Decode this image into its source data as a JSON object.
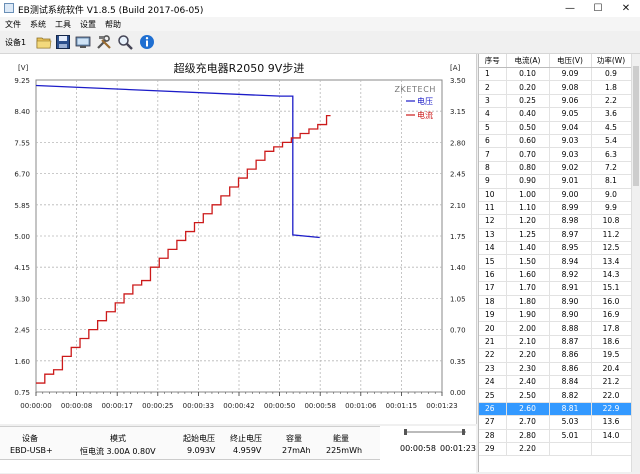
{
  "window": {
    "title": "EB测试系统软件 V1.8.5 (Build 2017-06-05)",
    "min_glyph": "—",
    "max_glyph": "☐",
    "close_glyph": "✕"
  },
  "menu": {
    "file": "文件",
    "system": "系统",
    "tools": "工具",
    "settings": "设置",
    "help": "帮助"
  },
  "toolbar": {
    "device_label": "设备1",
    "icons": [
      "open-folder-icon",
      "save-disk-icon",
      "monitor-icon",
      "tools-icon",
      "search-icon",
      "info-icon"
    ]
  },
  "chart_data": {
    "type": "line",
    "title": "超级充电器R2050 9V步进",
    "watermark": "ZKETECH",
    "left_unit": "[V]",
    "right_unit": "[A]",
    "y_left_ticks": [
      "9.25",
      "8.40",
      "7.55",
      "6.70",
      "5.85",
      "5.00",
      "4.15",
      "3.30",
      "2.45",
      "1.60",
      "0.75"
    ],
    "y_right_ticks": [
      "3.50",
      "3.15",
      "2.80",
      "2.45",
      "2.10",
      "1.75",
      "1.40",
      "1.05",
      "0.70",
      "0.35",
      "0.00"
    ],
    "x_ticks": [
      "00:00:00",
      "00:00:08",
      "00:00:17",
      "00:00:25",
      "00:00:33",
      "00:00:42",
      "00:00:50",
      "00:00:58",
      "00:01:06",
      "00:01:15",
      "00:01:23"
    ],
    "ylim_left": [
      0.75,
      9.25
    ],
    "ylim_right": [
      0.0,
      3.5
    ],
    "xlim_seconds": [
      0,
      83
    ],
    "grid": true,
    "legend_position": "top-right",
    "series": [
      {
        "name": "电压",
        "color": "#1c1cc8",
        "axis": "left",
        "x": [
          0,
          50,
          52.5,
          52.5,
          58
        ],
        "y": [
          9.1,
          8.81,
          8.81,
          5.03,
          4.96
        ]
      },
      {
        "name": "电流",
        "color": "#cc1a1a",
        "axis": "right",
        "step": true,
        "x": [
          0,
          1.8,
          3.6,
          5.4,
          7.2,
          9.0,
          10.8,
          12.6,
          14.4,
          16.2,
          18.0,
          19.8,
          21.6,
          23.4,
          25.2,
          27.0,
          28.8,
          30.6,
          32.4,
          34.2,
          36.0,
          37.8,
          39.6,
          41.4,
          43.2,
          45.0,
          46.8,
          48.6,
          50.4,
          52.2,
          54.0,
          55.8,
          57.6,
          59.4
        ],
        "y": [
          0.1,
          0.2,
          0.25,
          0.4,
          0.5,
          0.6,
          0.7,
          0.8,
          0.9,
          1.0,
          1.1,
          1.2,
          1.25,
          1.4,
          1.5,
          1.6,
          1.7,
          1.8,
          1.9,
          2.0,
          2.1,
          2.2,
          2.3,
          2.4,
          2.5,
          2.6,
          2.7,
          2.75,
          2.8,
          2.85,
          2.9,
          2.95,
          3.0,
          3.1
        ]
      }
    ]
  },
  "table": {
    "headers": [
      "序号",
      "电流(A)",
      "电压(V)",
      "功率(W)"
    ],
    "rows": [
      [
        "1",
        "0.10",
        "9.09",
        "0.9"
      ],
      [
        "2",
        "0.20",
        "9.08",
        "1.8"
      ],
      [
        "3",
        "0.25",
        "9.06",
        "2.2"
      ],
      [
        "4",
        "0.40",
        "9.05",
        "3.6"
      ],
      [
        "5",
        "0.50",
        "9.04",
        "4.5"
      ],
      [
        "6",
        "0.60",
        "9.03",
        "5.4"
      ],
      [
        "7",
        "0.70",
        "9.03",
        "6.3"
      ],
      [
        "8",
        "0.80",
        "9.02",
        "7.2"
      ],
      [
        "9",
        "0.90",
        "9.01",
        "8.1"
      ],
      [
        "10",
        "1.00",
        "9.00",
        "9.0"
      ],
      [
        "11",
        "1.10",
        "8.99",
        "9.9"
      ],
      [
        "12",
        "1.20",
        "8.98",
        "10.8"
      ],
      [
        "13",
        "1.25",
        "8.97",
        "11.2"
      ],
      [
        "14",
        "1.40",
        "8.95",
        "12.5"
      ],
      [
        "15",
        "1.50",
        "8.94",
        "13.4"
      ],
      [
        "16",
        "1.60",
        "8.92",
        "14.3"
      ],
      [
        "17",
        "1.70",
        "8.91",
        "15.1"
      ],
      [
        "18",
        "1.80",
        "8.90",
        "16.0"
      ],
      [
        "19",
        "1.90",
        "8.90",
        "16.9"
      ],
      [
        "20",
        "2.00",
        "8.88",
        "17.8"
      ],
      [
        "21",
        "2.10",
        "8.87",
        "18.6"
      ],
      [
        "22",
        "2.20",
        "8.86",
        "19.5"
      ],
      [
        "23",
        "2.30",
        "8.86",
        "20.4"
      ],
      [
        "24",
        "2.40",
        "8.84",
        "21.2"
      ],
      [
        "25",
        "2.50",
        "8.82",
        "22.0"
      ],
      [
        "26",
        "2.60",
        "8.81",
        "22.9"
      ],
      [
        "27",
        "2.70",
        "5.03",
        "13.6"
      ],
      [
        "28",
        "2.80",
        "5.01",
        "14.0"
      ],
      [
        "29",
        "2.20",
        "",
        ""
      ]
    ],
    "selected_index": 25
  },
  "stats": {
    "device": {
      "label": "设备",
      "value": "EBD-USB+"
    },
    "mode": {
      "label": "模式",
      "value": "恒电流  3.00A  0.80V"
    },
    "start_voltage": {
      "label": "起始电压",
      "value": "9.093V"
    },
    "end_voltage": {
      "label": "终止电压",
      "value": "4.959V"
    },
    "capacity": {
      "label": "容量",
      "value": "27mAh"
    },
    "energy": {
      "label": "能量",
      "value": "225mWh"
    },
    "elapsed": "00:00:58",
    "zoom_times": [
      "00:00:58",
      "00:01:23"
    ]
  }
}
